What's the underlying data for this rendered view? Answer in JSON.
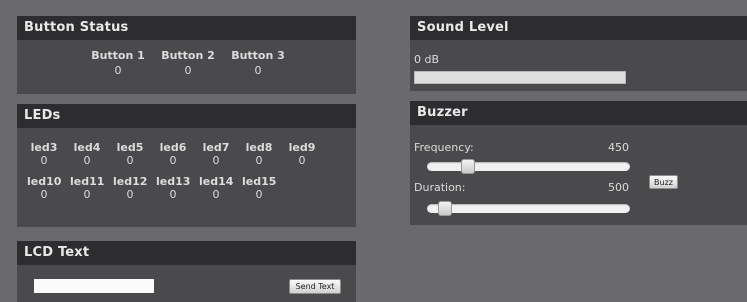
{
  "button_status": {
    "title": "Button Status",
    "buttons": [
      {
        "label": "Button 1",
        "value": "0"
      },
      {
        "label": "Button 2",
        "value": "0"
      },
      {
        "label": "Button 3",
        "value": "0"
      }
    ]
  },
  "leds": {
    "title": "LEDs",
    "row1": [
      {
        "label": "led3",
        "value": "0"
      },
      {
        "label": "led4",
        "value": "0"
      },
      {
        "label": "led5",
        "value": "0"
      },
      {
        "label": "led6",
        "value": "0"
      },
      {
        "label": "led7",
        "value": "0"
      },
      {
        "label": "led8",
        "value": "0"
      },
      {
        "label": "led9",
        "value": "0"
      }
    ],
    "row2": [
      {
        "label": "led10",
        "value": "0"
      },
      {
        "label": "led11",
        "value": "0"
      },
      {
        "label": "led12",
        "value": "0"
      },
      {
        "label": "led13",
        "value": "0"
      },
      {
        "label": "led14",
        "value": "0"
      },
      {
        "label": "led15",
        "value": "0"
      }
    ]
  },
  "lcd": {
    "title": "LCD Text",
    "input_value": "",
    "send_label": "Send Text"
  },
  "sound": {
    "title": "Sound Level",
    "value_text": "0 dB",
    "level_fraction": 0
  },
  "buzzer": {
    "title": "Buzzer",
    "frequency_label": "Frequency:",
    "frequency_value": "450",
    "frequency_fraction": 0.18,
    "duration_label": "Duration:",
    "duration_value": "500",
    "duration_fraction": 0.06,
    "buzz_label": "Buzz"
  },
  "colors": {
    "page_bg": "#6a6a6d",
    "panel_bg": "#4a4a4d",
    "header_bg": "#2d2d30"
  }
}
